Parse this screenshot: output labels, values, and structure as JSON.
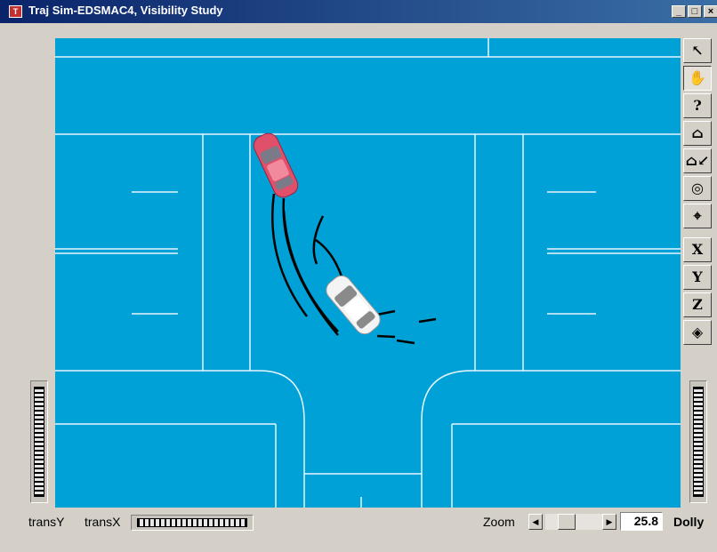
{
  "window": {
    "title": "Traj Sim-EDSMAC4, Visibility Study",
    "controls": [
      "minimize",
      "maximize",
      "close"
    ],
    "accent": "#0a246a"
  },
  "scene": {
    "background": "#00a1d6",
    "line_color": "#e8f6ff",
    "vehicles": [
      {
        "name": "red-car",
        "color": "#e0506a"
      },
      {
        "name": "white-car",
        "color": "#f4f4f4"
      }
    ]
  },
  "toolbar": {
    "tools": [
      {
        "name": "pick-arrow-icon",
        "glyph": "↖"
      },
      {
        "name": "hand-pan-icon",
        "glyph": "✋",
        "pressed": true
      },
      {
        "name": "help-icon",
        "glyph": "?"
      },
      {
        "name": "home-icon",
        "glyph": "⌂"
      },
      {
        "name": "set-home-icon",
        "glyph": "⌂↙"
      },
      {
        "name": "view-all-icon",
        "glyph": "◎"
      },
      {
        "name": "seek-icon",
        "glyph": "⌖"
      },
      {
        "name": "view-x-icon",
        "glyph": "X"
      },
      {
        "name": "view-y-icon",
        "glyph": "Y"
      },
      {
        "name": "view-z-icon",
        "glyph": "Z"
      },
      {
        "name": "perspective-icon",
        "glyph": "◈"
      }
    ]
  },
  "footer": {
    "transY": "transY",
    "transX": "transX",
    "zoom": "Zoom",
    "zoom_value": "25.8",
    "dolly": "Dolly"
  }
}
